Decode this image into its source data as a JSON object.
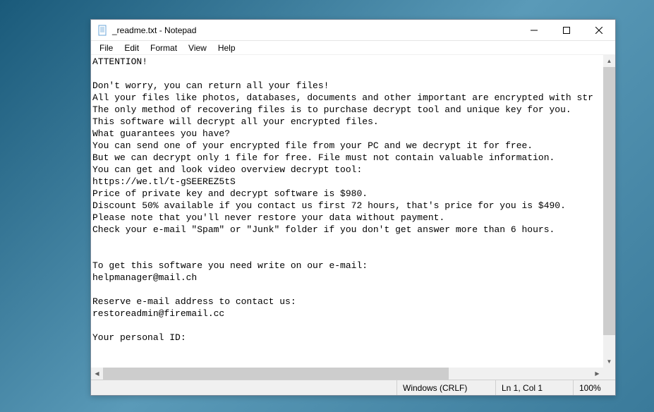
{
  "window": {
    "title": "_readme.txt - Notepad"
  },
  "menus": {
    "file": "File",
    "edit": "Edit",
    "format": "Format",
    "view": "View",
    "help": "Help"
  },
  "content": {
    "lines": [
      "ATTENTION!",
      "",
      "Don't worry, you can return all your files!",
      "All your files like photos, databases, documents and other important are encrypted with str",
      "The only method of recovering files is to purchase decrypt tool and unique key for you.",
      "This software will decrypt all your encrypted files.",
      "What guarantees you have?",
      "You can send one of your encrypted file from your PC and we decrypt it for free.",
      "But we can decrypt only 1 file for free. File must not contain valuable information.",
      "You can get and look video overview decrypt tool:",
      "https://we.tl/t-gSEEREZ5tS",
      "Price of private key and decrypt software is $980.",
      "Discount 50% available if you contact us first 72 hours, that's price for you is $490.",
      "Please note that you'll never restore your data without payment.",
      "Check your e-mail \"Spam\" or \"Junk\" folder if you don't get answer more than 6 hours.",
      "",
      "",
      "To get this software you need write on our e-mail:",
      "helpmanager@mail.ch",
      "",
      "Reserve e-mail address to contact us:",
      "restoreadmin@firemail.cc",
      "",
      "Your personal ID:"
    ]
  },
  "status": {
    "line_ending": "Windows (CRLF)",
    "cursor": "Ln 1, Col 1",
    "zoom": "100%"
  }
}
